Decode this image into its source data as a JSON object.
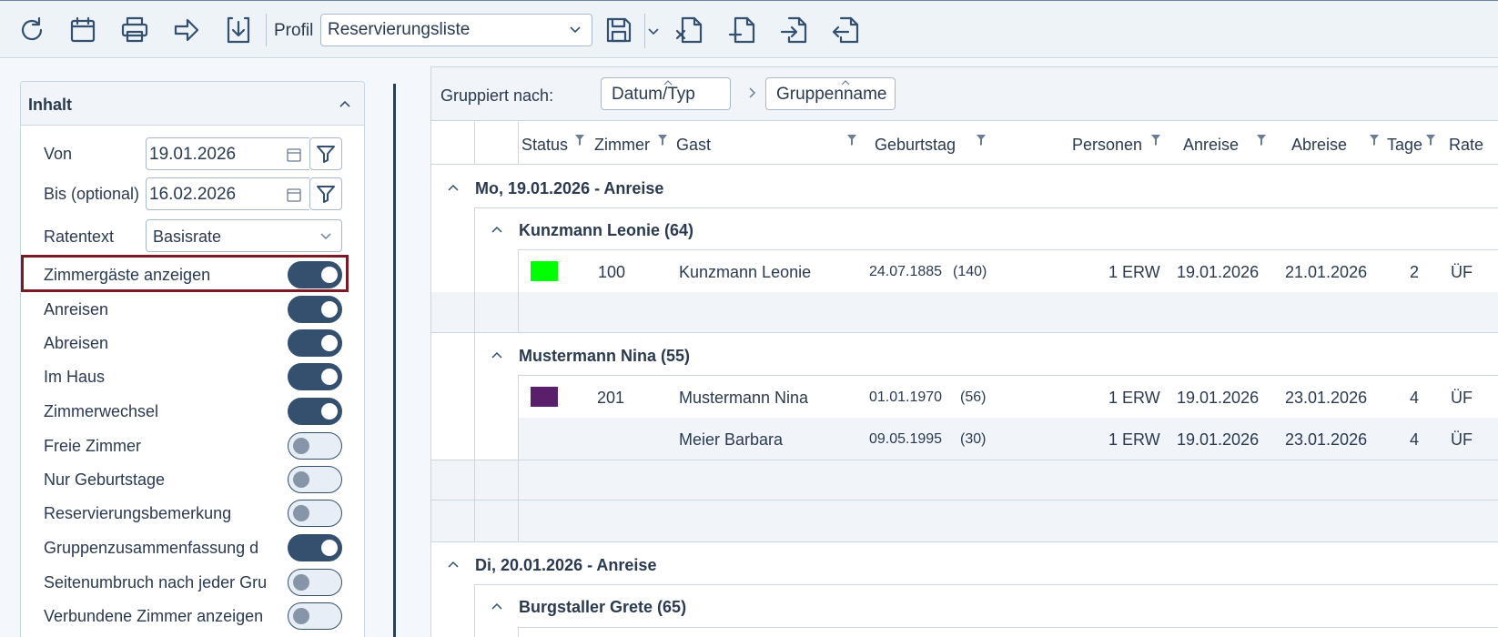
{
  "toolbar": {
    "profil_label": "Profil",
    "profil_value": "Reservierungsliste",
    "buttons": [
      "refresh-icon",
      "calendar-icon",
      "print-icon",
      "forward-icon",
      "download-icon",
      "save-icon",
      "export-x-icon",
      "add-file-icon",
      "import-icon",
      "export-icon"
    ]
  },
  "panel": {
    "title": "Inhalt",
    "von_label": "Von",
    "von_value": "19.01.2026",
    "bis_label": "Bis (optional)",
    "bis_value": "16.02.2026",
    "rate_label": "Ratentext",
    "rate_value": "Basisrate",
    "toggles": [
      {
        "label": "Zimmergäste anzeigen",
        "on": true
      },
      {
        "label": "Anreisen",
        "on": true
      },
      {
        "label": "Abreisen",
        "on": true
      },
      {
        "label": "Im Haus",
        "on": true
      },
      {
        "label": "Zimmerwechsel",
        "on": true
      },
      {
        "label": "Freie Zimmer",
        "on": false
      },
      {
        "label": "Nur Geburtstage",
        "on": false
      },
      {
        "label": "Reservierungsbemerkung",
        "on": false
      },
      {
        "label": "Gruppenzusammenfassung d",
        "on": true
      },
      {
        "label": "Seitenumbruch nach jeder Gru",
        "on": false
      },
      {
        "label": "Verbundene Zimmer anzeigen",
        "on": false
      }
    ]
  },
  "grid": {
    "grouped_by_label": "Gruppiert nach:",
    "group_chips": [
      "Datum/Typ",
      "Gruppenname"
    ],
    "columns": [
      "Status",
      "Zimmer",
      "Gast",
      "Geburtstag",
      "Personen",
      "Anreise",
      "Abreise",
      "Tage",
      "Rate"
    ],
    "groups": [
      {
        "title": "Mo, 19.01.2026 - Anreise",
        "subgroups": [
          {
            "title": "Kunzmann Leonie (64)",
            "rows": [
              {
                "status_color": "#00ff00",
                "zimmer": "100",
                "gast": "Kunzmann Leonie",
                "geburtstag": "24.07.1885",
                "alter": "(140)",
                "personen": "1 ERW",
                "anreise": "19.01.2026",
                "abreise": "21.01.2026",
                "tage": "2",
                "rate": "ÜF"
              }
            ]
          },
          {
            "title": "Mustermann Nina (55)",
            "rows": [
              {
                "status_color": "#5a1f6b",
                "zimmer": "201",
                "gast": "Mustermann Nina",
                "geburtstag": "01.01.1970",
                "alter": "(56)",
                "personen": "1 ERW",
                "anreise": "19.01.2026",
                "abreise": "23.01.2026",
                "tage": "4",
                "rate": "ÜF"
              },
              {
                "status_color": "",
                "zimmer": "",
                "gast": "Meier Barbara",
                "geburtstag": "09.05.1995",
                "alter": "(30)",
                "personen": "1 ERW",
                "anreise": "19.01.2026",
                "abreise": "23.01.2026",
                "tage": "4",
                "rate": "ÜF"
              }
            ]
          }
        ]
      },
      {
        "title": "Di, 20.01.2026 - Anreise",
        "subgroups": [
          {
            "title": "Burgstaller Grete (65)",
            "rows": []
          }
        ]
      }
    ]
  }
}
